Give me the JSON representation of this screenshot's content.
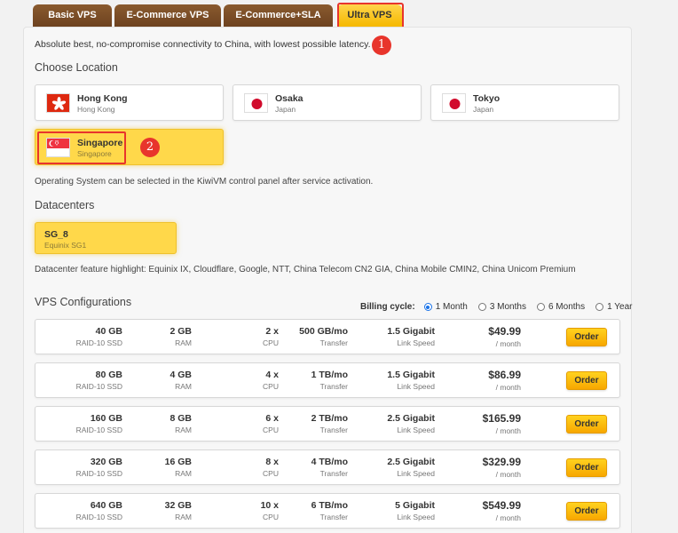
{
  "tabs": [
    {
      "label": "Basic VPS"
    },
    {
      "label": "E-Commerce VPS"
    },
    {
      "label": "E-Commerce+SLA"
    },
    {
      "label": "Ultra VPS"
    }
  ],
  "annotations": {
    "one": "1",
    "two": "2"
  },
  "intro": "Absolute best, no-compromise connectivity to China, with lowest possible latency.",
  "location_heading": "Choose Location",
  "locations": [
    {
      "name": "Hong Kong",
      "sub": "Hong Kong",
      "flag": "hong-kong-flag-icon"
    },
    {
      "name": "Osaka",
      "sub": "Japan",
      "flag": "japan-flag-icon"
    },
    {
      "name": "Tokyo",
      "sub": "Japan",
      "flag": "japan-flag-icon"
    },
    {
      "name": "Singapore",
      "sub": "Singapore",
      "flag": "singapore-flag-icon",
      "selected": true
    }
  ],
  "os_note": "Operating System can be selected in the KiwiVM control panel after service activation.",
  "datacenter_heading": "Datacenters",
  "datacenter": {
    "name": "SG_8",
    "sub": "Equinix SG1"
  },
  "feature_note": "Datacenter feature highlight: Equinix IX, Cloudflare, Google, NTT, China Telecom CN2 GIA, China Mobile CMIN2, China Unicom Premium",
  "config_heading": "VPS Configurations",
  "billing": {
    "label": "Billing cycle:",
    "options": [
      "1 Month",
      "3 Months",
      "6 Months",
      "1 Year"
    ],
    "selected": "1 Month"
  },
  "configs": [
    {
      "disk": "40 GB",
      "disk_label": "RAID-10 SSD",
      "ram": "2 GB",
      "ram_label": "RAM",
      "cpu": "2 x",
      "cpu_label": "CPU",
      "transfer": "500 GB/mo",
      "transfer_label": "Transfer",
      "link": "1.5 Gigabit",
      "link_label": "Link Speed",
      "price": "$49.99",
      "period": "/ month",
      "order": "Order"
    },
    {
      "disk": "80 GB",
      "disk_label": "RAID-10 SSD",
      "ram": "4 GB",
      "ram_label": "RAM",
      "cpu": "4 x",
      "cpu_label": "CPU",
      "transfer": "1 TB/mo",
      "transfer_label": "Transfer",
      "link": "1.5 Gigabit",
      "link_label": "Link Speed",
      "price": "$86.99",
      "period": "/ month",
      "order": "Order"
    },
    {
      "disk": "160 GB",
      "disk_label": "RAID-10 SSD",
      "ram": "8 GB",
      "ram_label": "RAM",
      "cpu": "6 x",
      "cpu_label": "CPU",
      "transfer": "2 TB/mo",
      "transfer_label": "Transfer",
      "link": "2.5 Gigabit",
      "link_label": "Link Speed",
      "price": "$165.99",
      "period": "/ month",
      "order": "Order"
    },
    {
      "disk": "320 GB",
      "disk_label": "RAID-10 SSD",
      "ram": "16 GB",
      "ram_label": "RAM",
      "cpu": "8 x",
      "cpu_label": "CPU",
      "transfer": "4 TB/mo",
      "transfer_label": "Transfer",
      "link": "2.5 Gigabit",
      "link_label": "Link Speed",
      "price": "$329.99",
      "period": "/ month",
      "order": "Order"
    },
    {
      "disk": "640 GB",
      "disk_label": "RAID-10 SSD",
      "ram": "32 GB",
      "ram_label": "RAM",
      "cpu": "10 x",
      "cpu_label": "CPU",
      "transfer": "6 TB/mo",
      "transfer_label": "Transfer",
      "link": "5 Gigabit",
      "link_label": "Link Speed",
      "price": "$549.99",
      "period": "/ month",
      "order": "Order"
    }
  ]
}
